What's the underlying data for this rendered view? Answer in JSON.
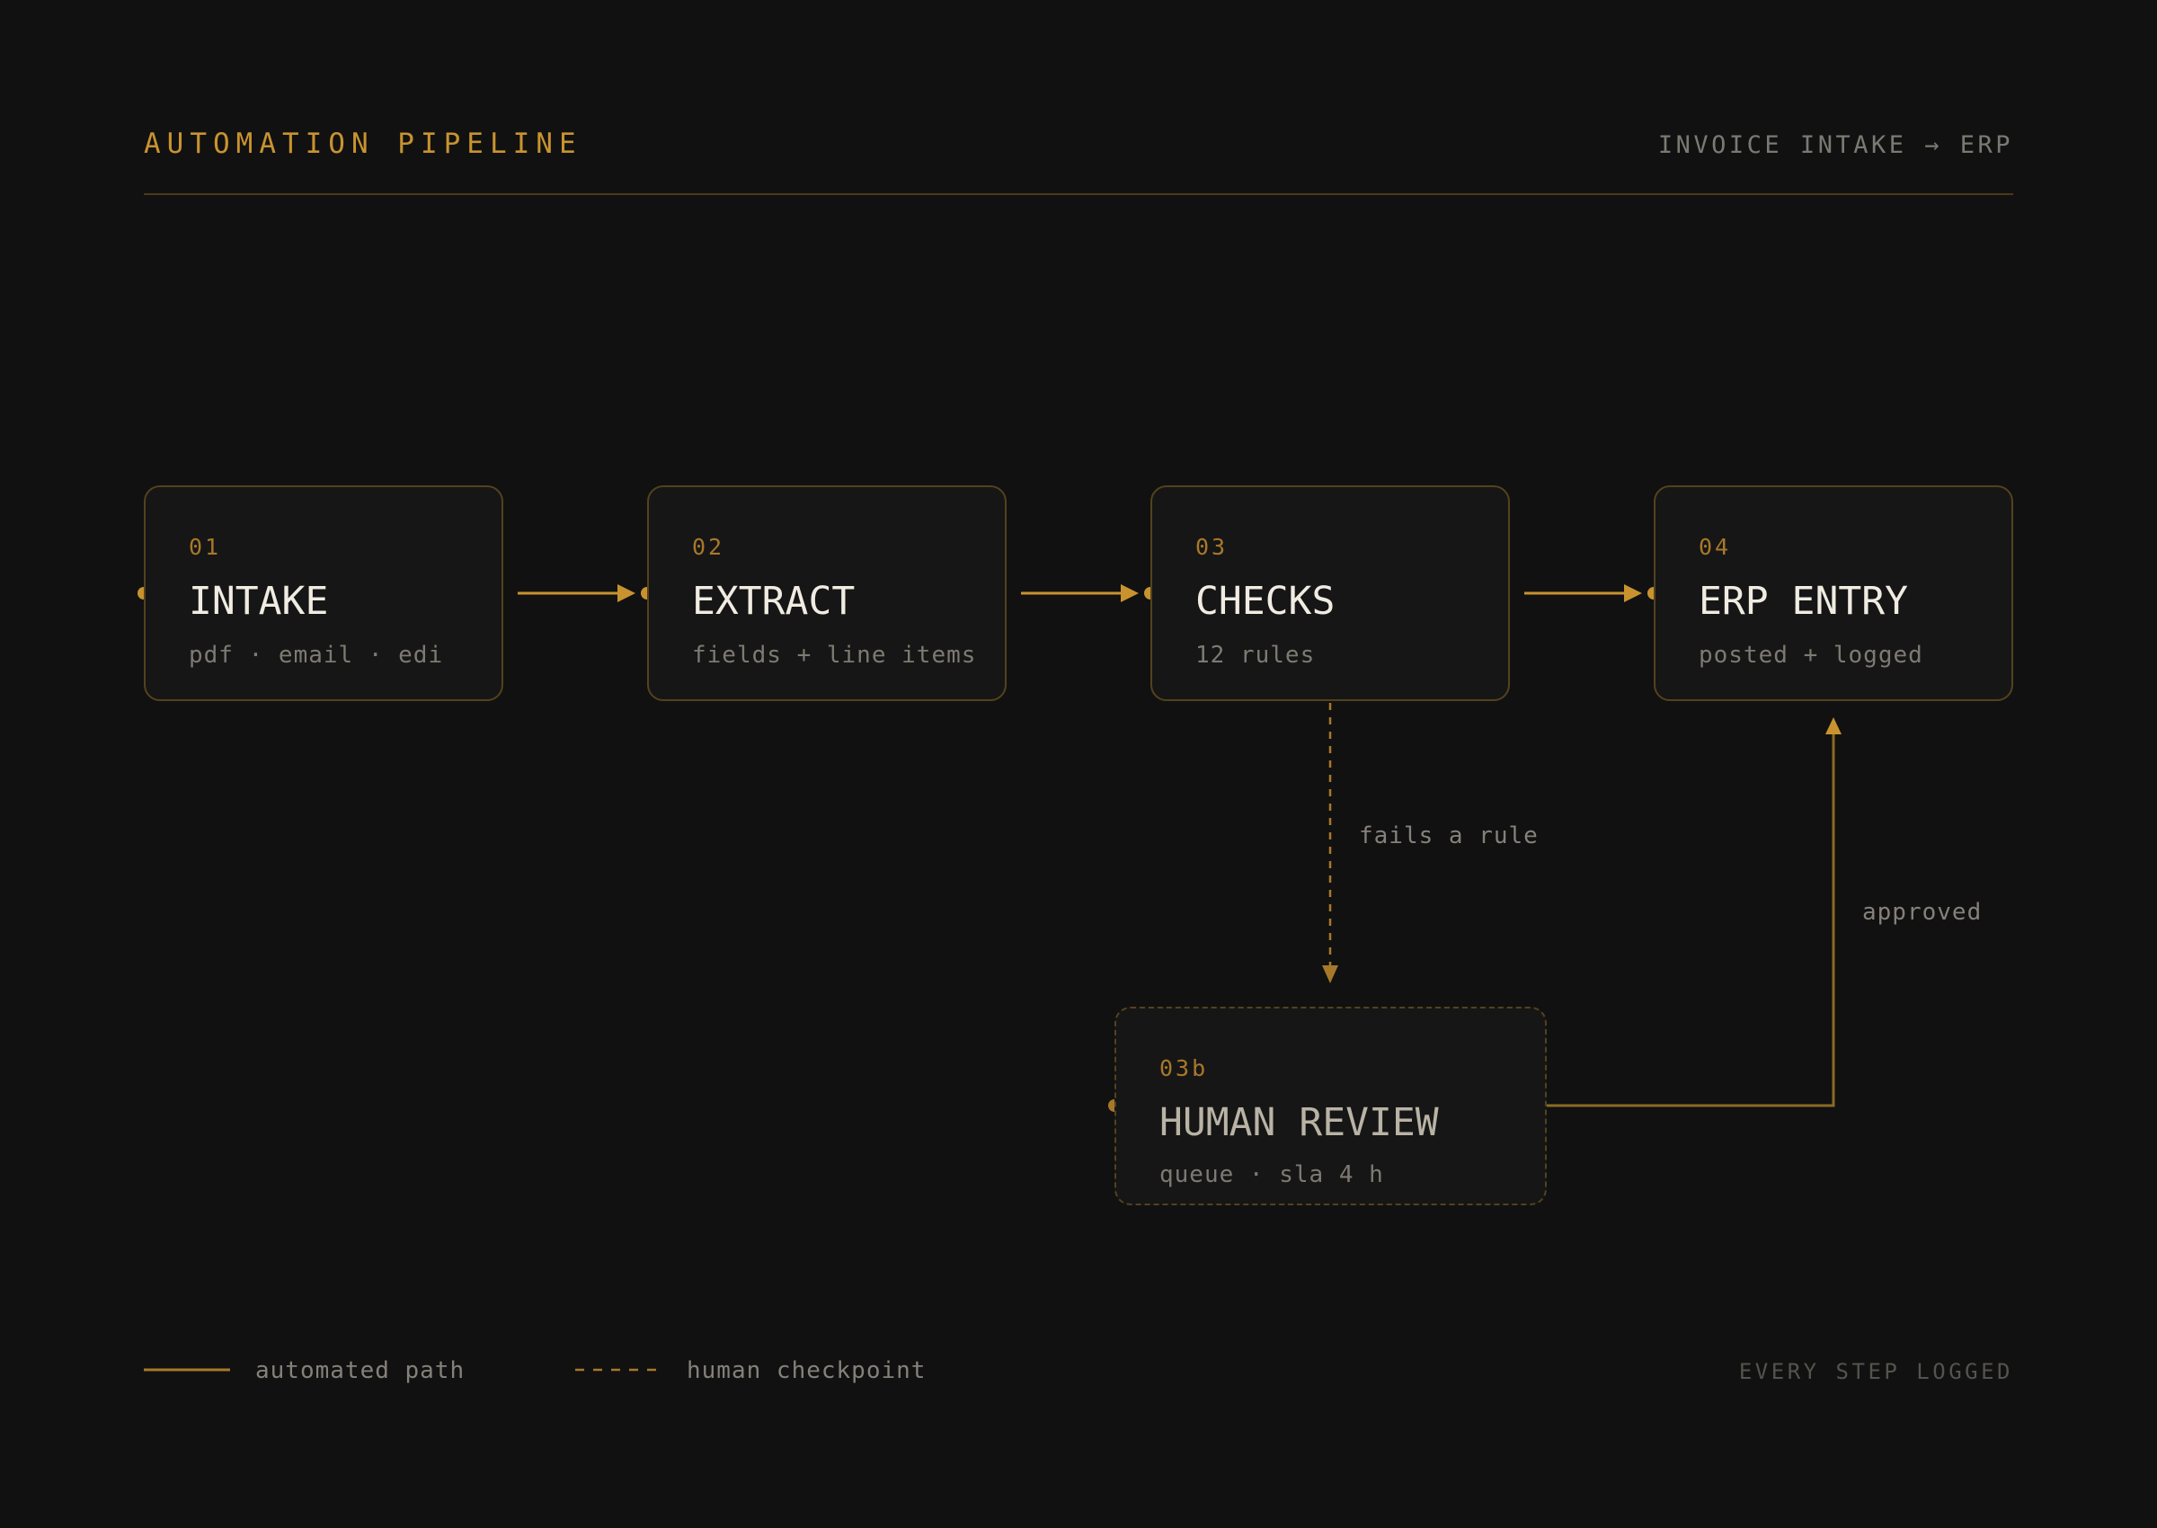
{
  "header": {
    "title": "AUTOMATION PIPELINE",
    "subtitle": "INVOICE INTAKE → ERP"
  },
  "nodes": [
    {
      "id": "intake",
      "number": "01",
      "title": "INTAKE",
      "description": "pdf · email · edi",
      "style": "solid"
    },
    {
      "id": "extract",
      "number": "02",
      "title": "EXTRACT",
      "description": "fields + line items",
      "style": "solid"
    },
    {
      "id": "checks",
      "number": "03",
      "title": "CHECKS",
      "description": "12 rules",
      "style": "solid"
    },
    {
      "id": "erp-entry",
      "number": "04",
      "title": "ERP ENTRY",
      "description": "posted + logged",
      "style": "solid"
    },
    {
      "id": "human-review",
      "number": "03b",
      "title": "HUMAN REVIEW",
      "description": "queue · sla 4 h",
      "style": "dashed"
    }
  ],
  "edges": [
    {
      "from": "intake",
      "to": "extract",
      "style": "solid",
      "label": ""
    },
    {
      "from": "extract",
      "to": "checks",
      "style": "solid",
      "label": ""
    },
    {
      "from": "checks",
      "to": "erp-entry",
      "style": "solid",
      "label": ""
    },
    {
      "from": "checks",
      "to": "human-review",
      "style": "dashed",
      "label": "fails a rule"
    },
    {
      "from": "human-review",
      "to": "erp-entry",
      "style": "solid",
      "label": "approved"
    }
  ],
  "legend": {
    "automated": "automated path",
    "human": "human checkpoint"
  },
  "footer": {
    "note": "EVERY STEP LOGGED"
  },
  "colors": {
    "background": "#111111",
    "accent": "#c8932f",
    "node_border": "#54421d",
    "title_text": "#f0ece2",
    "muted_text": "#7d7a72"
  }
}
